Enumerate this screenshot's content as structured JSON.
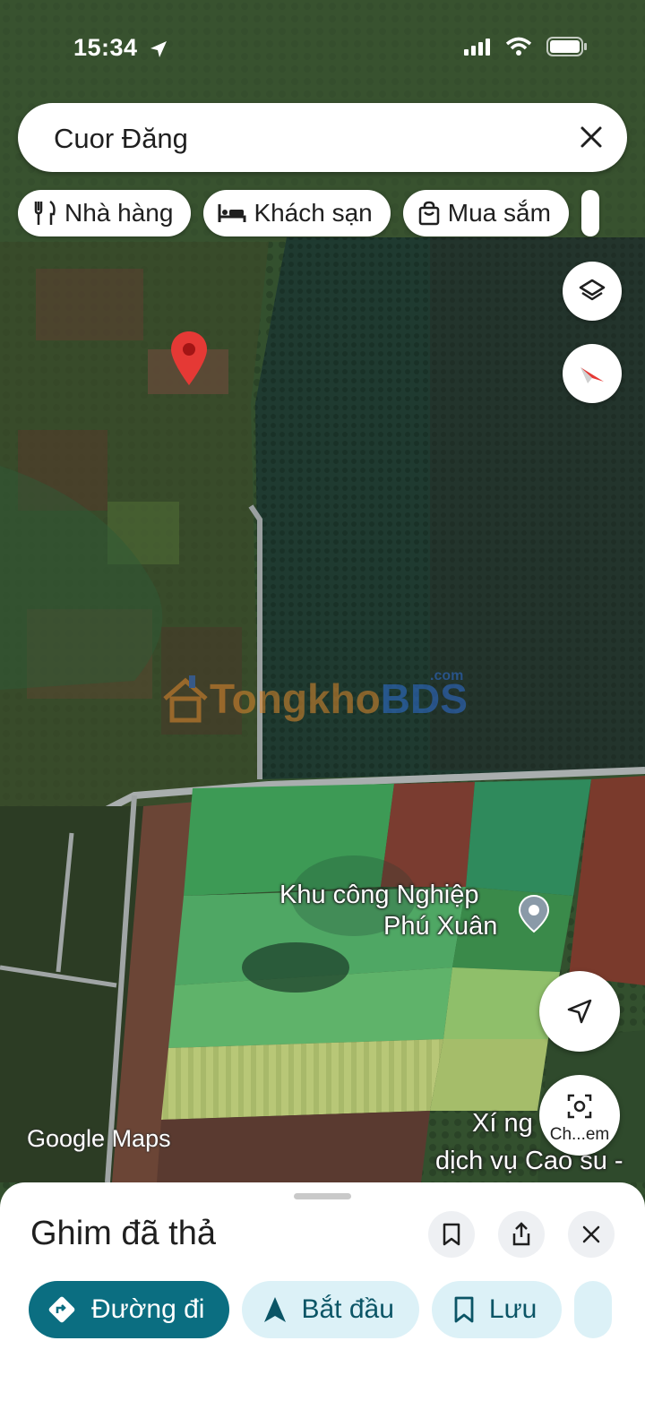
{
  "status_bar": {
    "time": "15:34"
  },
  "search": {
    "query": "Cuor Đăng"
  },
  "chips": [
    {
      "label": "Nhà hàng",
      "icon": "restaurant-icon"
    },
    {
      "label": "Khách sạn",
      "icon": "hotel-icon"
    },
    {
      "label": "Mua sắm",
      "icon": "shopping-bag-icon"
    }
  ],
  "map": {
    "labels": {
      "industrial_line1": "Khu công Nghiệp",
      "industrial_line2": "Phú Xuân",
      "factory_line1": "Xí ng",
      "factory_line2": "dịch vụ Cao su -"
    },
    "watermark": {
      "part1": "Tongkho",
      "part2": "BDS",
      "suffix": ".com"
    },
    "attribution": "Google Maps",
    "image_search_label": "Ch...em"
  },
  "sheet": {
    "title": "Ghim đã thả",
    "actions": [
      {
        "label": "Đường đi",
        "icon": "directions-icon",
        "primary": true
      },
      {
        "label": "Bắt đầu",
        "icon": "navigation-arrow-icon"
      },
      {
        "label": "Lưu",
        "icon": "bookmark-icon"
      }
    ]
  },
  "colors": {
    "accent": "#0b6e81",
    "action_bg": "#dcf1f7",
    "pin": "#e53935"
  }
}
